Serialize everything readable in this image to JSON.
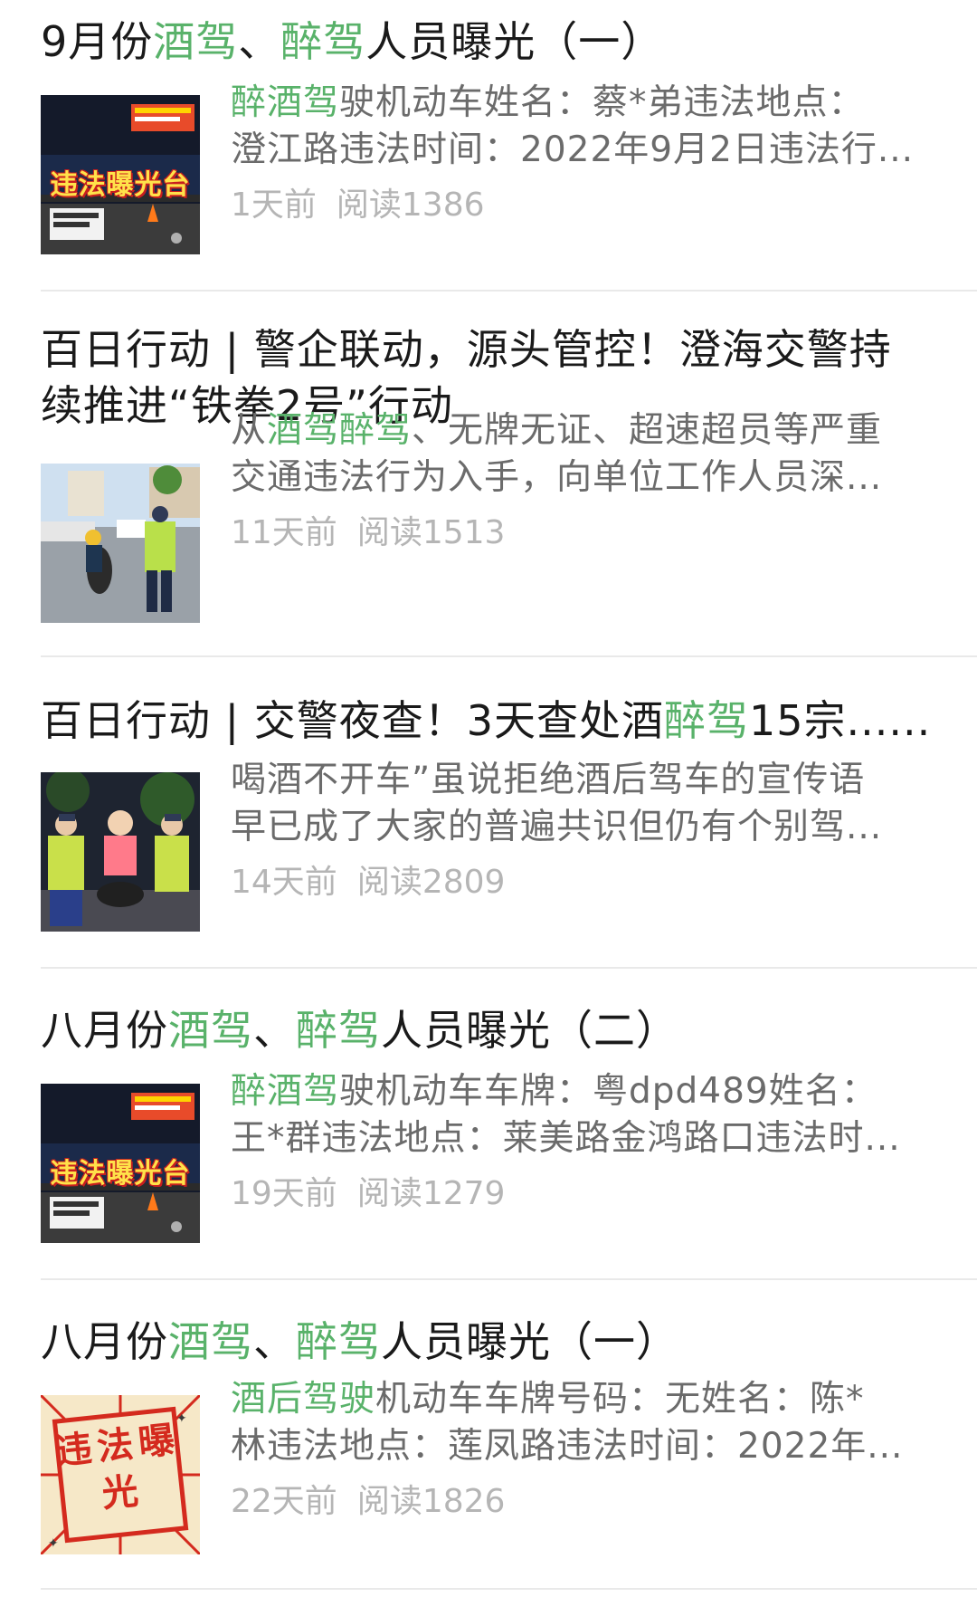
{
  "articles": [
    {
      "title_lines": [
        [
          {
            "text": "9月份",
            "hl": false
          },
          {
            "text": "酒驾",
            "hl": true
          },
          {
            "text": "、",
            "hl": false
          },
          {
            "text": "醉驾",
            "hl": true
          },
          {
            "text": "人员曝光（一）",
            "hl": false
          }
        ]
      ],
      "thumbnail": {
        "kind": "night-billboard",
        "caption": "违法曝光台"
      },
      "summary_lines": [
        [
          {
            "text": "醉酒驾",
            "hl": true
          },
          {
            "text": "驶机动车姓名：蔡*弟违法地点：",
            "hl": false
          }
        ],
        [
          {
            "text": "澄江路违法时间：2022年9月2日违法行...",
            "hl": false
          }
        ]
      ],
      "time": "1天前",
      "reads": "阅读1386"
    },
    {
      "title_lines": [
        [
          {
            "text": "百日行动 | 警企联动，源头管控！澄海交警持",
            "hl": false
          }
        ],
        [
          {
            "text": "续推进“铁拳2号”行动",
            "hl": false
          }
        ]
      ],
      "thumbnail": {
        "kind": "street-police",
        "caption": ""
      },
      "summary_lines": [
        [
          {
            "text": "从",
            "hl": false
          },
          {
            "text": "酒驾醉驾",
            "hl": true
          },
          {
            "text": "、无牌无证、超速超员等严重",
            "hl": false
          }
        ],
        [
          {
            "text": "交通违法行为入手，向单位工作人员深...",
            "hl": false
          }
        ]
      ],
      "time": "11天前",
      "reads": "阅读1513"
    },
    {
      "title_lines": [
        [
          {
            "text": "百日行动 | 交警夜查！3天查处酒",
            "hl": false
          },
          {
            "text": "醉驾",
            "hl": true
          },
          {
            "text": "15宗......",
            "hl": false
          }
        ]
      ],
      "thumbnail": {
        "kind": "night-police",
        "caption": ""
      },
      "summary_lines": [
        [
          {
            "text": "喝酒不开车”虽说拒绝酒后驾车的宣传语",
            "hl": false
          }
        ],
        [
          {
            "text": "早已成了大家的普遍共识但仍有个别驾...",
            "hl": false
          }
        ]
      ],
      "time": "14天前",
      "reads": "阅读2809"
    },
    {
      "title_lines": [
        [
          {
            "text": "八月份",
            "hl": false
          },
          {
            "text": "酒驾",
            "hl": true
          },
          {
            "text": "、",
            "hl": false
          },
          {
            "text": "醉驾",
            "hl": true
          },
          {
            "text": "人员曝光（二）",
            "hl": false
          }
        ]
      ],
      "thumbnail": {
        "kind": "night-billboard",
        "caption": "违法曝光台"
      },
      "summary_lines": [
        [
          {
            "text": "醉酒驾",
            "hl": true
          },
          {
            "text": "驶机动车车牌：粤dpd489姓名：",
            "hl": false
          }
        ],
        [
          {
            "text": "王*群违法地点：莱美路金鸿路口违法时...",
            "hl": false
          }
        ]
      ],
      "time": "19天前",
      "reads": "阅读1279"
    },
    {
      "title_lines": [
        [
          {
            "text": "八月份",
            "hl": false
          },
          {
            "text": "酒驾",
            "hl": true
          },
          {
            "text": "、",
            "hl": false
          },
          {
            "text": "醉驾",
            "hl": true
          },
          {
            "text": "人员曝光（一）",
            "hl": false
          }
        ]
      ],
      "thumbnail": {
        "kind": "red-stamp",
        "caption": "违法曝光"
      },
      "summary_lines": [
        [
          {
            "text": "酒后驾驶",
            "hl": true
          },
          {
            "text": "机动车车牌号码：无姓名：陈*",
            "hl": false
          }
        ],
        [
          {
            "text": "林违法地点：莲凤路违法时间：2022年...",
            "hl": false
          }
        ]
      ],
      "time": "22天前",
      "reads": "阅读1826"
    }
  ],
  "colors": {
    "highlight": "#59b26a",
    "title": "#1a1a1a",
    "summary": "#6b6b6b",
    "meta": "#b5b5b5",
    "divider": "#e9e9e9"
  }
}
